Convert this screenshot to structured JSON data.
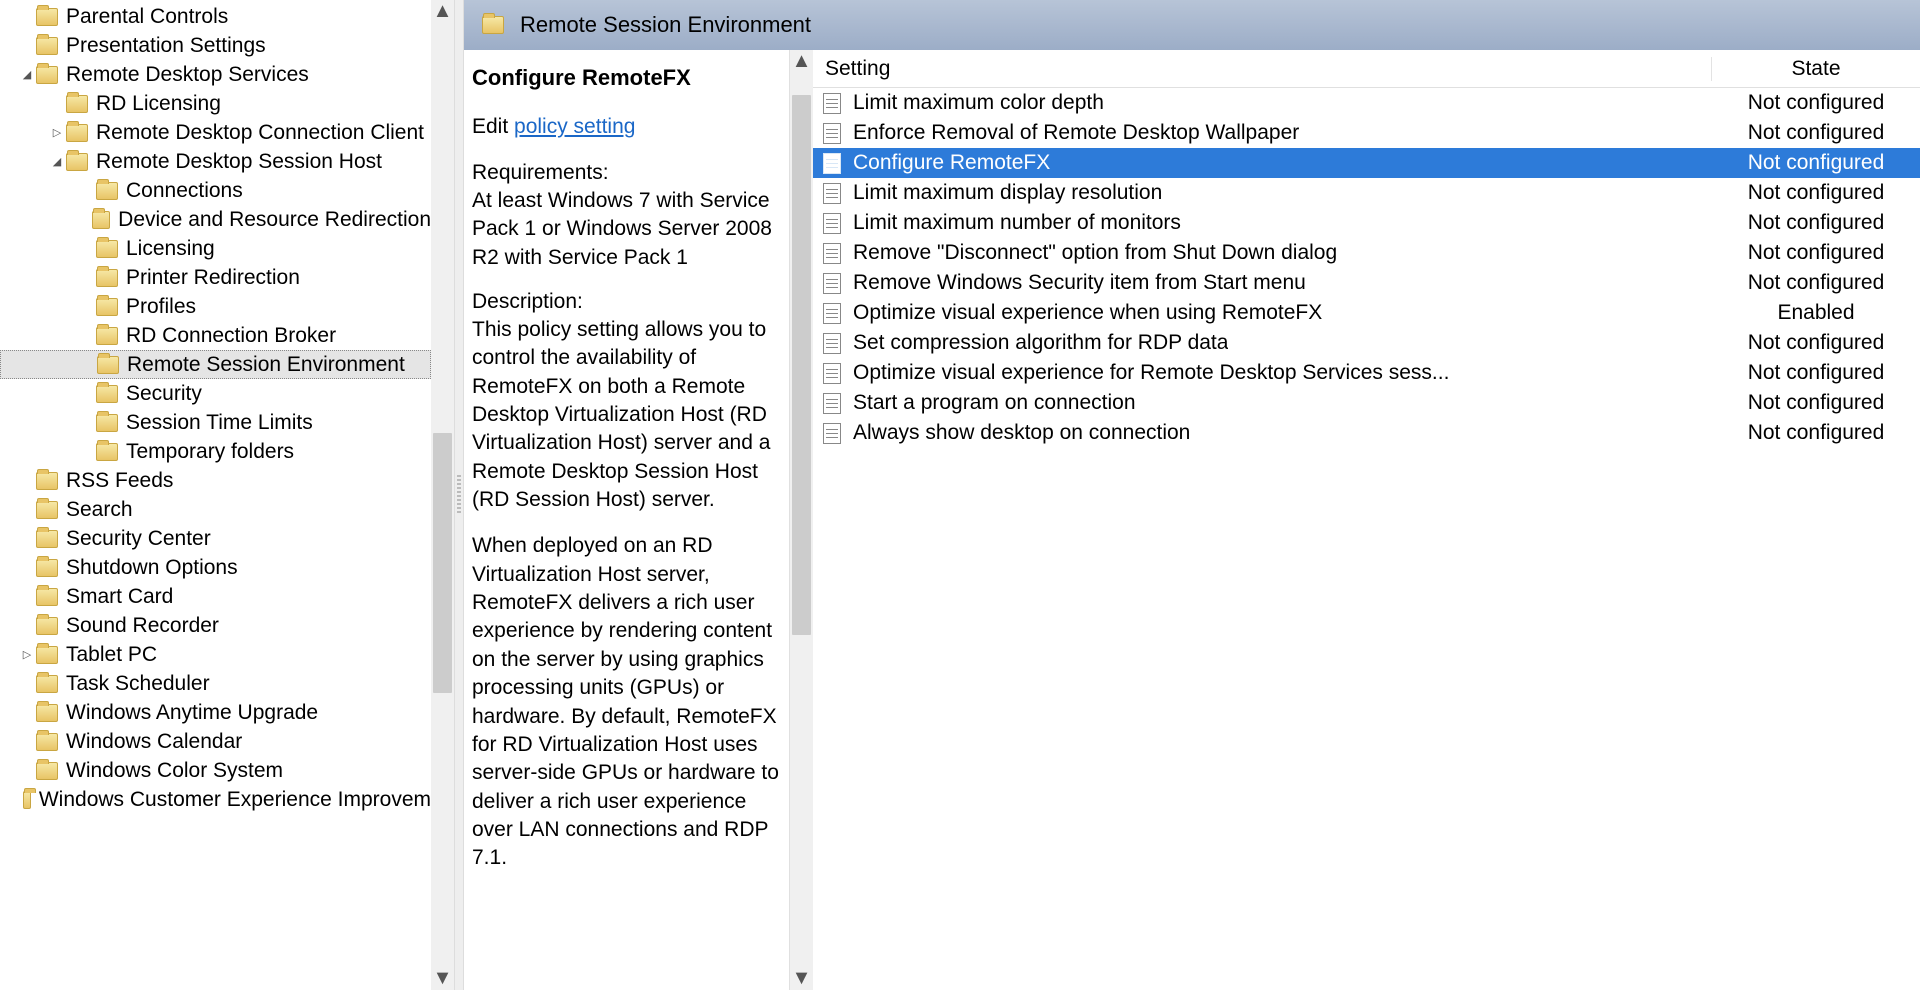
{
  "header": {
    "title": "Remote Session Environment"
  },
  "tree": [
    {
      "indent": 1,
      "expander": "none",
      "label": "Parental Controls"
    },
    {
      "indent": 1,
      "expander": "none",
      "label": "Presentation Settings"
    },
    {
      "indent": 1,
      "expander": "open",
      "label": "Remote Desktop Services"
    },
    {
      "indent": 2,
      "expander": "none",
      "label": "RD Licensing"
    },
    {
      "indent": 2,
      "expander": "closed",
      "label": "Remote Desktop Connection Client"
    },
    {
      "indent": 2,
      "expander": "open",
      "label": "Remote Desktop Session Host"
    },
    {
      "indent": 3,
      "expander": "none",
      "label": "Connections"
    },
    {
      "indent": 3,
      "expander": "none",
      "label": "Device and Resource Redirection"
    },
    {
      "indent": 3,
      "expander": "none",
      "label": "Licensing"
    },
    {
      "indent": 3,
      "expander": "none",
      "label": "Printer Redirection"
    },
    {
      "indent": 3,
      "expander": "none",
      "label": "Profiles"
    },
    {
      "indent": 3,
      "expander": "none",
      "label": "RD Connection Broker"
    },
    {
      "indent": 3,
      "expander": "none",
      "label": "Remote Session Environment",
      "selected": true
    },
    {
      "indent": 3,
      "expander": "none",
      "label": "Security"
    },
    {
      "indent": 3,
      "expander": "none",
      "label": "Session Time Limits"
    },
    {
      "indent": 3,
      "expander": "none",
      "label": "Temporary folders"
    },
    {
      "indent": 1,
      "expander": "none",
      "label": "RSS Feeds"
    },
    {
      "indent": 1,
      "expander": "none",
      "label": "Search"
    },
    {
      "indent": 1,
      "expander": "none",
      "label": "Security Center"
    },
    {
      "indent": 1,
      "expander": "none",
      "label": "Shutdown Options"
    },
    {
      "indent": 1,
      "expander": "none",
      "label": "Smart Card"
    },
    {
      "indent": 1,
      "expander": "none",
      "label": "Sound Recorder"
    },
    {
      "indent": 1,
      "expander": "closed",
      "label": "Tablet PC"
    },
    {
      "indent": 1,
      "expander": "none",
      "label": "Task Scheduler"
    },
    {
      "indent": 1,
      "expander": "none",
      "label": "Windows Anytime Upgrade"
    },
    {
      "indent": 1,
      "expander": "none",
      "label": "Windows Calendar"
    },
    {
      "indent": 1,
      "expander": "none",
      "label": "Windows Color System"
    },
    {
      "indent": 1,
      "expander": "none",
      "label": "Windows Customer Experience Improvem"
    }
  ],
  "info": {
    "title": "Configure RemoteFX",
    "edit_prefix": "Edit ",
    "edit_link": "policy setting ",
    "req_label": "Requirements:",
    "req_text": "At least Windows 7 with Service Pack 1 or Windows Server 2008 R2 with Service Pack 1",
    "desc_label": "Description:",
    "desc_p1": "This policy setting allows you to control the availability of RemoteFX on both a Remote Desktop Virtualization Host (RD Virtualization Host) server and a Remote Desktop Session Host (RD Session Host) server.",
    "desc_p2": "When deployed on an RD Virtualization Host server, RemoteFX delivers a rich user experience by rendering content on the server by using graphics processing units (GPUs) or hardware. By default, RemoteFX for RD Virtualization Host uses server-side GPUs or hardware to deliver a rich user experience over LAN connections and RDP 7.1."
  },
  "columns": {
    "setting": "Setting",
    "state": "State"
  },
  "settings": [
    {
      "name": "Limit maximum color depth",
      "state": "Not configured"
    },
    {
      "name": "Enforce Removal of Remote Desktop Wallpaper",
      "state": "Not configured"
    },
    {
      "name": "Configure RemoteFX",
      "state": "Not configured",
      "selected": true
    },
    {
      "name": "Limit maximum display resolution",
      "state": "Not configured"
    },
    {
      "name": "Limit maximum number of monitors",
      "state": "Not configured"
    },
    {
      "name": "Remove \"Disconnect\" option from Shut Down dialog",
      "state": "Not configured"
    },
    {
      "name": "Remove Windows Security item from Start menu",
      "state": "Not configured"
    },
    {
      "name": "Optimize visual experience when using RemoteFX",
      "state": "Enabled"
    },
    {
      "name": "Set compression algorithm for RDP data",
      "state": "Not configured"
    },
    {
      "name": "Optimize visual experience for Remote Desktop Services sess...",
      "state": "Not configured"
    },
    {
      "name": "Start a program on connection",
      "state": "Not configured"
    },
    {
      "name": "Always show desktop on connection",
      "state": "Not configured"
    }
  ]
}
